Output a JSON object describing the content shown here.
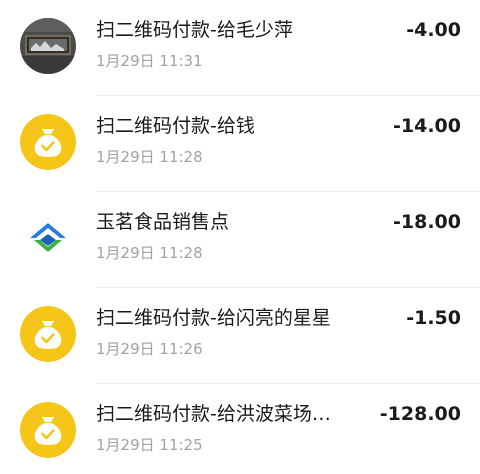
{
  "transactions": [
    {
      "icon": "photo-avatar",
      "title": "扫二维码付款-给毛少萍",
      "time": "1月29日 11:31",
      "amount": "-4.00"
    },
    {
      "icon": "money-bag-icon",
      "title": "扫二维码付款-给钱",
      "time": "1月29日 11:28",
      "amount": "-14.00"
    },
    {
      "icon": "merchant-logo-icon",
      "title": "玉茗食品销售点",
      "time": "1月29日 11:28",
      "amount": "-18.00"
    },
    {
      "icon": "money-bag-icon",
      "title": "扫二维码付款-给闪亮的星星",
      "time": "1月29日 11:26",
      "amount": "-1.50"
    },
    {
      "icon": "money-bag-icon",
      "title": "扫二维码付款-给洪波菜场…",
      "time": "1月29日 11:25",
      "amount": "-128.00"
    }
  ],
  "colors": {
    "money_bag_yellow": "#f5c518",
    "merchant_blue": "#2a7de1",
    "merchant_green": "#3cb043",
    "text_primary": "#1a1a1a",
    "text_secondary": "#a2a2a2"
  }
}
